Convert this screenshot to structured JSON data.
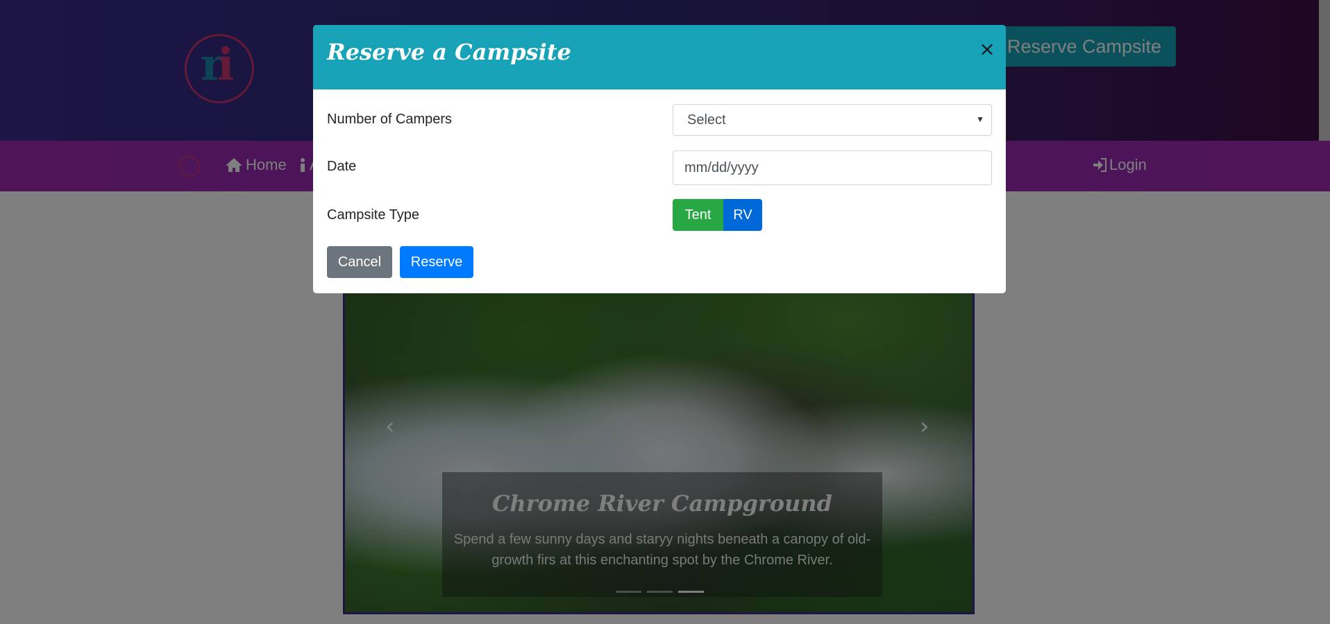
{
  "header": {
    "reserve_button": "Reserve Campsite"
  },
  "nav": {
    "items": [
      {
        "label": "Home",
        "icon": "home-icon"
      },
      {
        "label": "A",
        "icon": "info-icon"
      }
    ],
    "login": {
      "label": "Login",
      "icon": "sign-in-icon"
    }
  },
  "carousel": {
    "title": "Chrome River Campground",
    "text": "Spend a few sunny days and staryy nights beneath a canopy of old-growth firs at this enchanting spot by the Chrome River.",
    "slide_count": 3,
    "active_index": 2,
    "prev_glyph": "‹",
    "next_glyph": "›"
  },
  "modal": {
    "title": "Reserve a Campsite",
    "close_glyph": "×",
    "fields": {
      "campers_label": "Number of Campers",
      "campers_value": "Select",
      "date_label": "Date",
      "date_placeholder": "mm/dd/yyyy",
      "type_label": "Campsite Type",
      "type_options": [
        "Tent",
        "RV"
      ]
    },
    "buttons": {
      "cancel": "Cancel",
      "reserve": "Reserve"
    }
  },
  "colors": {
    "modal_header": "#17a2b8",
    "tent_button": "#28a745",
    "rv_button": "#0069d9",
    "cancel_button": "#6c757d",
    "reserve_button": "#007bff",
    "nav": "#a12bb0"
  }
}
